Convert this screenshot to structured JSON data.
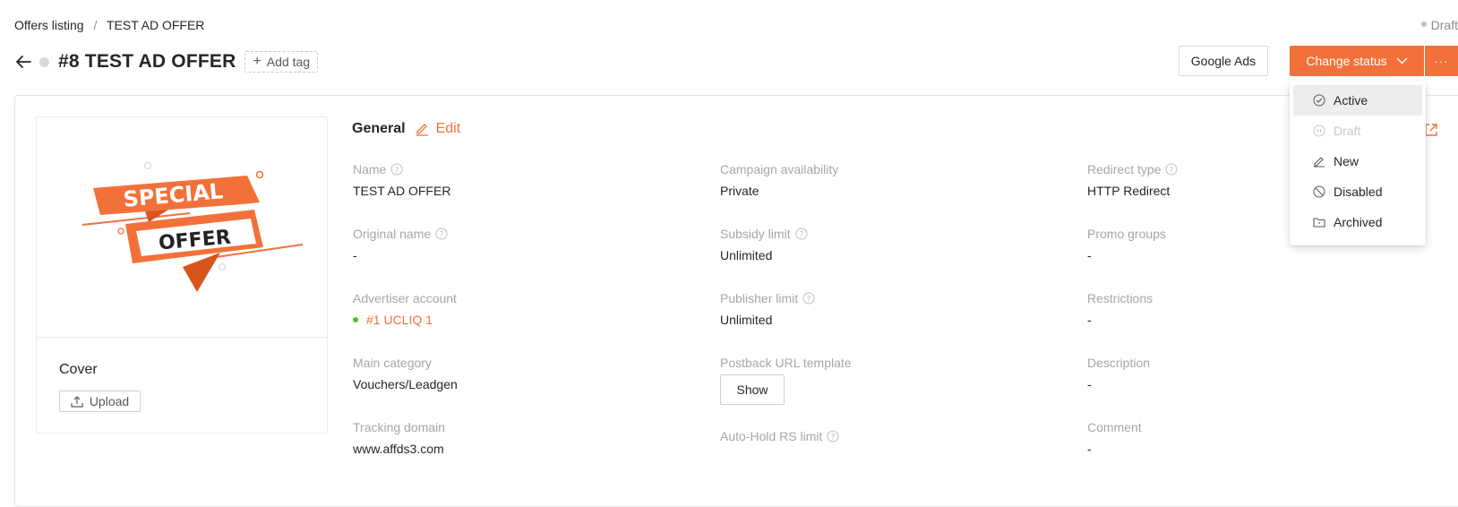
{
  "breadcrumb": {
    "parent": "Offers listing",
    "separator": "/",
    "current": "TEST AD OFFER"
  },
  "status_top": "Draft",
  "header": {
    "title": "#8 TEST AD OFFER",
    "add_tag": "Add tag"
  },
  "actions": {
    "google_ads": "Google Ads",
    "change_status": "Change status",
    "more": "···"
  },
  "status_menu": [
    {
      "label": "Active",
      "icon": "check-circle-icon",
      "state": "hover"
    },
    {
      "label": "Draft",
      "icon": "pause-circle-icon",
      "state": "disabled"
    },
    {
      "label": "New",
      "icon": "pencil-icon",
      "state": "normal"
    },
    {
      "label": "Disabled",
      "icon": "stop-icon",
      "state": "normal"
    },
    {
      "label": "Archived",
      "icon": "archive-folder-icon",
      "state": "normal"
    }
  ],
  "cover": {
    "label": "Cover",
    "upload": "Upload",
    "image_text_1": "SPECIAL",
    "image_text_2": "OFFER"
  },
  "general": {
    "title": "General",
    "edit": "Edit",
    "fields": {
      "name": {
        "label": "Name",
        "value": "TEST AD OFFER"
      },
      "original_name": {
        "label": "Original name",
        "value": "-"
      },
      "advertiser_account": {
        "label": "Advertiser account",
        "value": "#1 UCLIQ 1"
      },
      "main_category": {
        "label": "Main category",
        "value": "Vouchers/Leadgen"
      },
      "tracking_domain": {
        "label": "Tracking domain",
        "value": "www.affds3.com"
      },
      "campaign_availability": {
        "label": "Campaign availability",
        "value": "Private"
      },
      "subsidy_limit": {
        "label": "Subsidy limit",
        "value": "Unlimited"
      },
      "publisher_limit": {
        "label": "Publisher limit",
        "value": "Unlimited"
      },
      "postback_url_template": {
        "label": "Postback URL template",
        "button": "Show"
      },
      "auto_hold_rs_limit": {
        "label": "Auto-Hold RS limit"
      },
      "redirect_type": {
        "label": "Redirect type",
        "value": "HTTP Redirect"
      },
      "promo_groups": {
        "label": "Promo groups",
        "value": "-"
      },
      "restrictions": {
        "label": "Restrictions",
        "value": "-"
      },
      "description": {
        "label": "Description",
        "value": "-"
      },
      "comment": {
        "label": "Comment",
        "value": "-"
      }
    }
  },
  "colors": {
    "accent": "#f2713a",
    "muted": "#a6a6a6",
    "text": "#262626",
    "online": "#52c41a"
  }
}
